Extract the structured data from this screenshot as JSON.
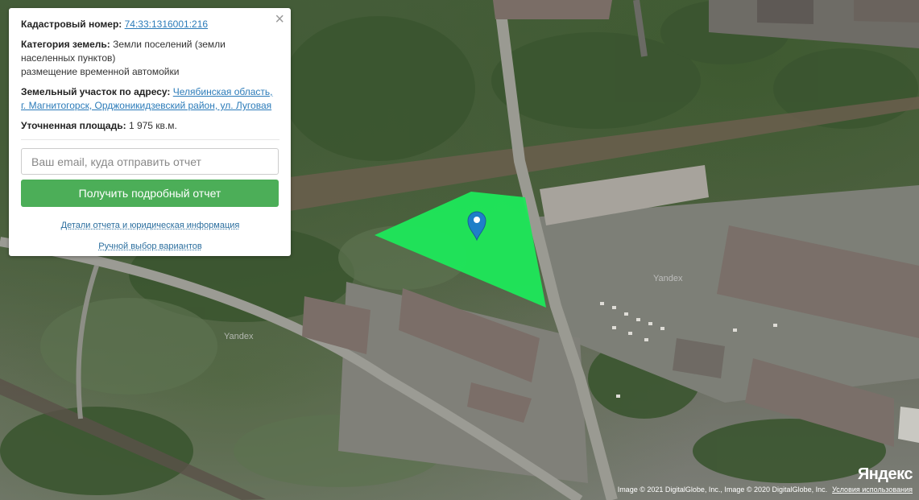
{
  "popup": {
    "close_symbol": "×",
    "cadastral_label": "Кадастровый номер:",
    "cadastral_value": "74:33:1316001:216",
    "category_label": "Категория земель:",
    "category_value": "Земли поселений (земли населенных пунктов)",
    "category_use": "размещение временной автомойки",
    "address_label": "Земельный участок по адресу:",
    "address_value": "Челябинская область, г. Магнитогорск, Орджоникидзевский район, ул. Луговая",
    "area_label": "Уточненная площадь:",
    "area_value": "1 975 кв.м.",
    "email_placeholder": "Ваш email, куда отправить отчет",
    "report_button": "Получить подробный отчет",
    "details_link": "Детали отчета и юридическая информация",
    "manual_link": "Ручной выбор вариантов"
  },
  "map": {
    "watermark_1": "Yandex",
    "watermark_2": "Yandex",
    "logo": "Яндекс",
    "copyright": "Image © 2021 DigitalGlobe, Inc., Image © 2020 DigitalGlobe, Inc.",
    "terms_link": "Условия использования",
    "parcel_color": "#1ee85a",
    "marker_color": "#1f7fc8"
  },
  "icons": [
    "close-icon",
    "map-marker-icon"
  ]
}
